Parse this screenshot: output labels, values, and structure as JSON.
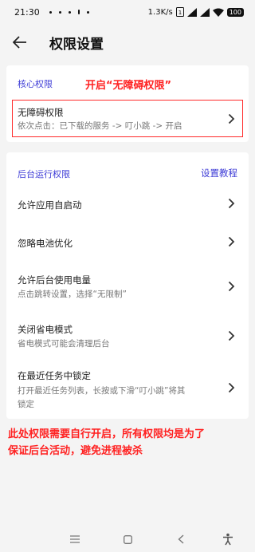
{
  "status_bar": {
    "time": "21:30",
    "network_speed": "1.3K/s",
    "battery": "100"
  },
  "header": {
    "title": "权限设置",
    "back_icon": "arrow-left-icon"
  },
  "core_section": {
    "label": "核心权限",
    "annotation": "开启“无障碍权限”",
    "items": [
      {
        "title": "无障碍权限",
        "subtitle": "依次点击：已下载的服务 -> 叮小跳 -> 开启"
      }
    ]
  },
  "background_section": {
    "label": "后台运行权限",
    "tutorial_link": "设置教程",
    "items": [
      {
        "title": "允许应用自启动",
        "subtitle": ""
      },
      {
        "title": "忽略电池优化",
        "subtitle": ""
      },
      {
        "title": "允许后台使用电量",
        "subtitle": "点击跳转设置，选择“无限制”"
      },
      {
        "title": "关闭省电模式",
        "subtitle": "省电模式可能会清理后台"
      },
      {
        "title": "在最近任务中锁定",
        "subtitle_line1": "打开最近任务列表，长按或下滑“叮小跳”将其",
        "subtitle_line2": "锁定"
      }
    ]
  },
  "bottom_note": {
    "line1": "此处权限需要自行开启，所有权限均是为了",
    "line2": "保证后台活动，避免进程被杀"
  },
  "colors": {
    "accent": "#3d3bd6",
    "annotation_red": "#ff2222",
    "background": "#f4f4f4"
  }
}
